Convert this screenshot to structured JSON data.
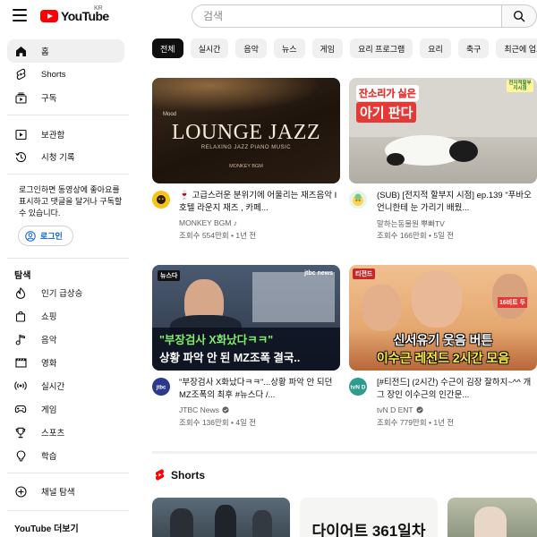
{
  "header": {
    "logo_text": "YouTube",
    "region": "KR",
    "search_placeholder": "검색"
  },
  "sidebar": {
    "main": [
      {
        "label": "홈",
        "icon": "home-icon"
      },
      {
        "label": "Shorts",
        "icon": "shorts-icon"
      },
      {
        "label": "구독",
        "icon": "subscriptions-icon"
      }
    ],
    "library": [
      {
        "label": "보관함",
        "icon": "library-icon"
      },
      {
        "label": "시청 기록",
        "icon": "history-icon"
      }
    ],
    "login_prompt": "로그인하면 동영상에 좋아요를 표시하고 댓글을 달거나 구독할 수 있습니다.",
    "login_button": "로그인",
    "explore_title": "탐색",
    "explore": [
      {
        "label": "인기 급상승",
        "icon": "trending-icon"
      },
      {
        "label": "쇼핑",
        "icon": "shopping-icon"
      },
      {
        "label": "음악",
        "icon": "music-icon"
      },
      {
        "label": "영화",
        "icon": "movie-icon"
      },
      {
        "label": "실시간",
        "icon": "live-icon"
      },
      {
        "label": "게임",
        "icon": "gaming-icon"
      },
      {
        "label": "스포츠",
        "icon": "sports-icon"
      },
      {
        "label": "학습",
        "icon": "learning-icon"
      }
    ],
    "browse_channels": "채널 탐색",
    "more_title": "YouTube 더보기"
  },
  "chips": [
    "전체",
    "실시간",
    "음악",
    "뉴스",
    "게임",
    "요리 프로그램",
    "요리",
    "축구",
    "최근에 업로드"
  ],
  "videos": [
    {
      "title": "🍷 고급스러운 분위기에 어울리는 재즈음악 I 호텔 라운지 재즈 , 카페...",
      "channel": "MONKEY BGM ♪",
      "meta": "조회수 554만회 • 1년 전",
      "thumb_text": "LOUNGE JAZZ",
      "thumb_sub": "RELAXING JAZZ PIANO MUSIC",
      "thumb_brand": "MONKEY BGM",
      "thumb_small": "Mood"
    },
    {
      "title": "(SUB) [전지적 할부지 시점] ep.139 \"푸바오 언니한테 눈 가리기 배웠...",
      "channel": "말하는동물원 뿌빠TV",
      "meta": "조회수 166만회 • 5일 전",
      "thumb_line1": "잔소리가 싫은",
      "thumb_line2": "아기 판다",
      "thumb_badge": "전지적할부지시점"
    },
    {
      "title": "\"부장검사 X화났다ㅋㅋ\"...상황 파악 안 되던 MZ조폭의 최후 #뉴스다 /...",
      "channel": "JTBC News",
      "meta": "조회수 136만회 • 4일 전",
      "thumb_line1": "\"부장검사 X화났다ㅋㅋ\"",
      "thumb_line2": "상황 파악 안 된 MZ조폭 결국..",
      "thumb_tag": "뉴스다",
      "thumb_logo": "jtbc news"
    },
    {
      "title": "[#티전드] (2시간) 수근이 김장 잘하지~^^ 개그 장인 이수근의 인간문...",
      "channel": "tvN D ENT",
      "meta": "조회수 779만회 • 1년 전",
      "thumb_line1": "신서유기 웃음 버튼",
      "thumb_line2": "이수근 레전드 2시간 모음",
      "thumb_tag": "티전드",
      "thumb_small": "16비트 두"
    }
  ],
  "shorts": {
    "title": "Shorts",
    "items": [
      {
        "text": ""
      },
      {
        "text": "다이어트 361일차"
      },
      {
        "text": ""
      }
    ]
  },
  "colors": {
    "brand_red": "#ff0000",
    "link_blue": "#065fd4",
    "chip_bg": "#f0f0f0",
    "text_secondary": "#606060"
  }
}
